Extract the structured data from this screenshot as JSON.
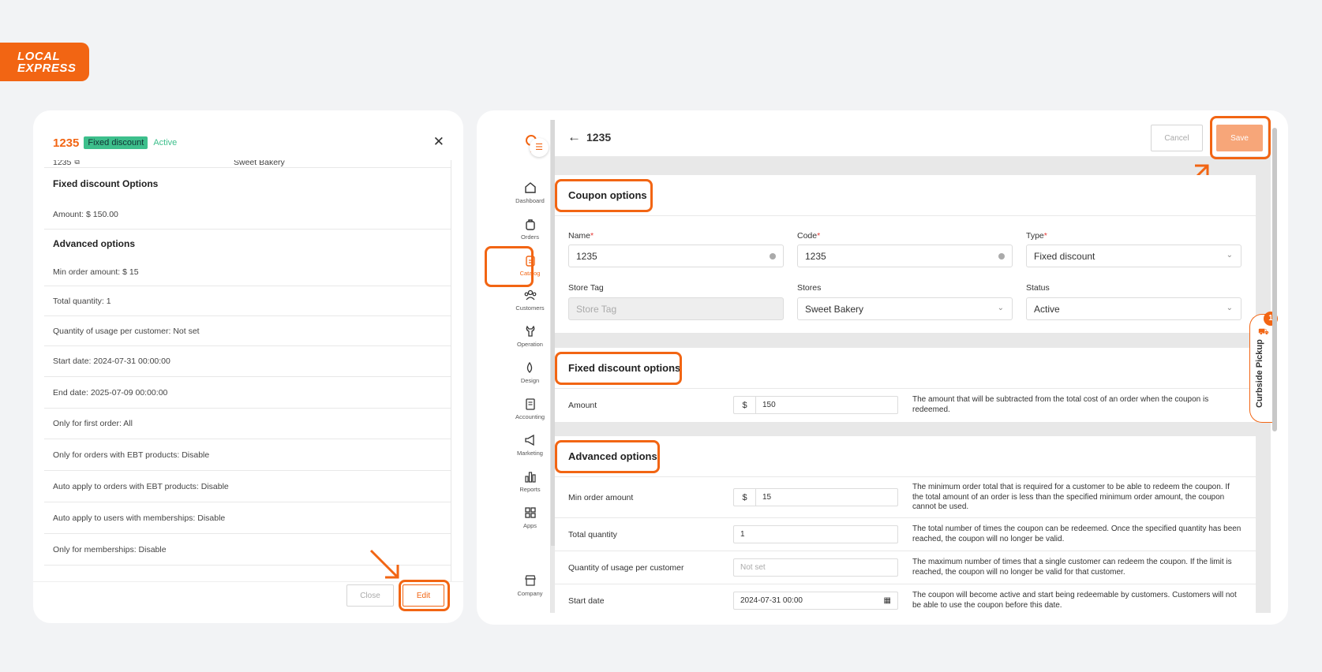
{
  "brand": {
    "line1": "LOCAL",
    "line2": "EXPRESS"
  },
  "left_panel": {
    "code": "1235",
    "type_tag": "Fixed discount",
    "status": "Active",
    "close_icon": "close-icon",
    "partial_row": {
      "code": "1235",
      "store": "Sweet Bakery"
    },
    "sections": [
      {
        "title": "Fixed discount Options",
        "rows": [
          "Amount:  $ 150.00"
        ]
      },
      {
        "title": "Advanced options",
        "rows": [
          "Min order amount:  $ 15",
          "Total quantity:  1",
          "Quantity of usage per customer:  Not set",
          "Start date:  2024-07-31 00:00:00",
          "End date:  2025-07-09 00:00:00",
          "Only for first order:  All",
          "Only for orders with EBT products:  Disable",
          "Auto apply to orders with EBT products:  Disable",
          "Auto apply to users with memberships:  Disable",
          "Only for memberships:  Disable"
        ]
      }
    ],
    "close_label": "Close",
    "edit_label": "Edit"
  },
  "sidebar": {
    "items": [
      {
        "label": "Dashboard",
        "icon": "home-icon"
      },
      {
        "label": "Orders",
        "icon": "bag-icon"
      },
      {
        "label": "Catalog",
        "icon": "clipboard-icon",
        "active": true
      },
      {
        "label": "Customers",
        "icon": "users-icon"
      },
      {
        "label": "Operation",
        "icon": "wrench-icon"
      },
      {
        "label": "Design",
        "icon": "drops-icon"
      },
      {
        "label": "Accounting",
        "icon": "receipt-icon"
      },
      {
        "label": "Marketing",
        "icon": "megaphone-icon"
      },
      {
        "label": "Reports",
        "icon": "bar-chart-icon"
      },
      {
        "label": "Apps",
        "icon": "grid-icon"
      },
      {
        "label": "Company",
        "icon": "store-icon"
      }
    ]
  },
  "editor": {
    "title": "1235",
    "cancel_label": "Cancel",
    "save_label": "Save",
    "coupon_options": {
      "title": "Coupon options",
      "name_label": "Name",
      "name_value": "1235",
      "code_label": "Code",
      "code_value": "1235",
      "type_label": "Type",
      "type_value": "Fixed discount",
      "store_tag_label": "Store Tag",
      "store_tag_placeholder": "Store Tag",
      "stores_label": "Stores",
      "stores_value": "Sweet Bakery",
      "status_label": "Status",
      "status_value": "Active",
      "required_mark": "*"
    },
    "fixed_discount": {
      "title": "Fixed discount options",
      "amount_label": "Amount",
      "currency": "$",
      "amount_value": "150",
      "amount_desc": "The amount that will be subtracted from the total cost of an order when the coupon is redeemed."
    },
    "advanced": {
      "title": "Advanced options",
      "rows": [
        {
          "label": "Min order amount",
          "currency": "$",
          "value": "15",
          "desc": "The minimum order total that is required for a customer to be able to redeem the coupon. If the total amount of an order is less than the specified minimum order amount, the coupon cannot be used."
        },
        {
          "label": "Total quantity",
          "value": "1",
          "desc": "The total number of times the coupon can be redeemed. Once the specified quantity has been reached, the coupon will no longer be valid."
        },
        {
          "label": "Quantity of usage per customer",
          "placeholder": "Not set",
          "desc": "The maximum number of times that a single customer can redeem the coupon. If the limit is reached, the coupon will no longer be valid for that customer."
        },
        {
          "label": "Start date",
          "value": "2024-07-31 00:00",
          "desc": "The coupon will become active and start being redeemable by customers. Customers will not be able to use the coupon before this date."
        }
      ]
    }
  },
  "curbside": {
    "label": "Curbside Pickup",
    "count": "1"
  },
  "colors": {
    "accent": "#f26513",
    "active_green": "#3dbf8c"
  }
}
